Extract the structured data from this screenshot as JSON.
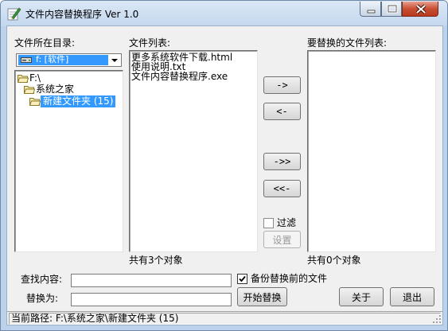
{
  "window": {
    "title": "文件内容替换程序 Ver 1.0"
  },
  "directory_panel": {
    "label": "文件所在目录:",
    "drive_selector": {
      "selected": "f: [软件]"
    },
    "tree": [
      {
        "label": "F:\\",
        "level": 0,
        "selected": false
      },
      {
        "label": "系统之家",
        "level": 1,
        "selected": false
      },
      {
        "label": "新建文件夹 (15)",
        "level": 2,
        "selected": true
      }
    ]
  },
  "file_list": {
    "label": "文件列表:",
    "items": [
      "更多系统软件下载.html",
      "使用说明.txt",
      "文件内容替换程序.exe"
    ],
    "count_text": "共有3个对象"
  },
  "transfer_buttons": {
    "add": "->",
    "remove": "<-",
    "add_all": "->>",
    "remove_all": "<<-"
  },
  "filter": {
    "label": "过滤",
    "checked": false,
    "settings_button": "设置"
  },
  "replace_list": {
    "label": "要替换的文件列表:",
    "items": [],
    "count_text": "共有0个对象"
  },
  "form": {
    "find_label": "查找内容:",
    "find_value": "",
    "replace_label": "替换为:",
    "replace_value": "",
    "backup_label": "备份替换前的文件",
    "backup_checked": true,
    "start_button": "开始替换",
    "about_button": "关于",
    "exit_button": "退出"
  },
  "status": {
    "text": "当前路径: F:\\系统之家\\新建文件夹 (15)"
  }
}
